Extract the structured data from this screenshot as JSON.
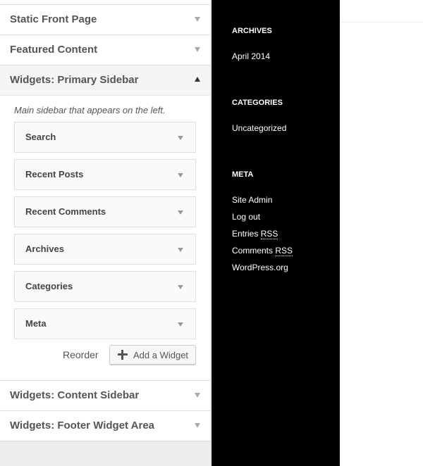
{
  "customizer": {
    "sections_top": [
      {
        "title": "Static Front Page"
      },
      {
        "title": "Featured Content"
      }
    ],
    "open_section": {
      "title": "Widgets: Primary Sidebar",
      "description": "Main sidebar that appears on the left.",
      "widgets": [
        {
          "title": "Search"
        },
        {
          "title": "Recent Posts"
        },
        {
          "title": "Recent Comments"
        },
        {
          "title": "Archives"
        },
        {
          "title": "Categories"
        },
        {
          "title": "Meta"
        }
      ],
      "reorder_label": "Reorder",
      "add_widget_label": "Add a Widget"
    },
    "sections_bottom": [
      {
        "title": "Widgets: Content Sidebar"
      },
      {
        "title": "Widgets: Footer Widget Area"
      }
    ]
  },
  "preview": {
    "archives": {
      "heading": "ARCHIVES",
      "links": [
        "April 2014"
      ]
    },
    "categories": {
      "heading": "CATEGORIES",
      "links": [
        "Uncategorized"
      ]
    },
    "meta": {
      "heading": "META",
      "links": [
        "Site Admin",
        "Log out"
      ],
      "entries_prefix": "Entries",
      "comments_prefix": "Comments",
      "rss_abbr": "RSS",
      "wordpress": "WordPress.org"
    }
  },
  "colors": {
    "sidebar_bg": "#000000",
    "panel_bg": "#eeeeee"
  }
}
